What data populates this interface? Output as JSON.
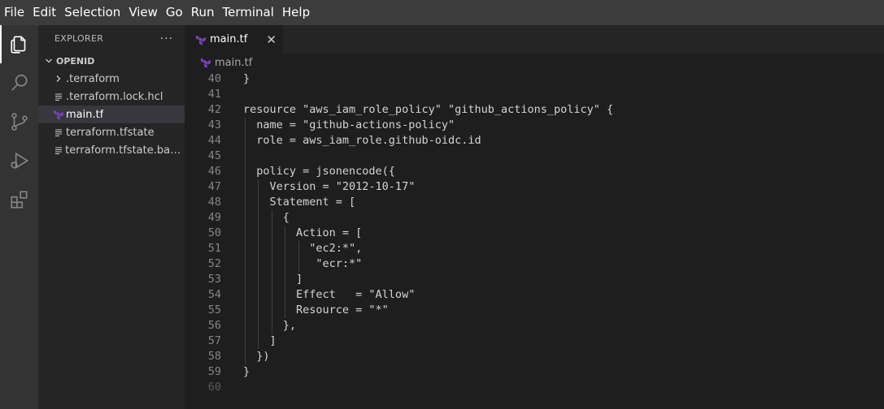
{
  "menubar": {
    "items": [
      "File",
      "Edit",
      "Selection",
      "View",
      "Go",
      "Run",
      "Terminal",
      "Help"
    ]
  },
  "activitybar": {
    "icons": [
      "files-icon",
      "search-icon",
      "source-control-icon",
      "run-debug-icon",
      "extensions-icon"
    ]
  },
  "explorer": {
    "title": "EXPLORER",
    "more": "···",
    "folder": "OPENID",
    "files": [
      {
        "label": ".terraform",
        "icon": "chevron-right-icon"
      },
      {
        "label": ".terraform.lock.hcl",
        "icon": "file-lines-icon"
      },
      {
        "label": "main.tf",
        "icon": "terraform-icon",
        "selected": true
      },
      {
        "label": "terraform.tfstate",
        "icon": "file-lines-icon"
      },
      {
        "label": "terraform.tfstate.back...",
        "icon": "file-lines-icon"
      }
    ]
  },
  "tab": {
    "label": "main.tf",
    "close": "✕"
  },
  "breadcrumb": {
    "label": "main.tf"
  },
  "colors": {
    "terraform": "#7b42bc",
    "background": "#1e1e1e",
    "sidebar": "#252526",
    "menubar": "#3c3c3c"
  },
  "editor": {
    "lines": [
      {
        "n": "40",
        "text": "}"
      },
      {
        "n": "41",
        "text": ""
      },
      {
        "n": "42",
        "text": "resource \"aws_iam_role_policy\" \"github_actions_policy\" {"
      },
      {
        "n": "43",
        "text": "  name = \"github-actions-policy\""
      },
      {
        "n": "44",
        "text": "  role = aws_iam_role.github-oidc.id"
      },
      {
        "n": "45",
        "text": ""
      },
      {
        "n": "46",
        "text": "  policy = jsonencode({"
      },
      {
        "n": "47",
        "text": "    Version = \"2012-10-17\""
      },
      {
        "n": "48",
        "text": "    Statement = ["
      },
      {
        "n": "49",
        "text": "      {"
      },
      {
        "n": "50",
        "text": "        Action = ["
      },
      {
        "n": "51",
        "text": "          \"ec2:*\","
      },
      {
        "n": "52",
        "text": "           \"ecr:*\""
      },
      {
        "n": "53",
        "text": "        ]"
      },
      {
        "n": "54",
        "text": "        Effect   = \"Allow\""
      },
      {
        "n": "55",
        "text": "        Resource = \"*\""
      },
      {
        "n": "56",
        "text": "      },"
      },
      {
        "n": "57",
        "text": "    ]"
      },
      {
        "n": "58",
        "text": "  })"
      },
      {
        "n": "59",
        "text": "}"
      },
      {
        "n": "60",
        "text": ""
      }
    ]
  }
}
